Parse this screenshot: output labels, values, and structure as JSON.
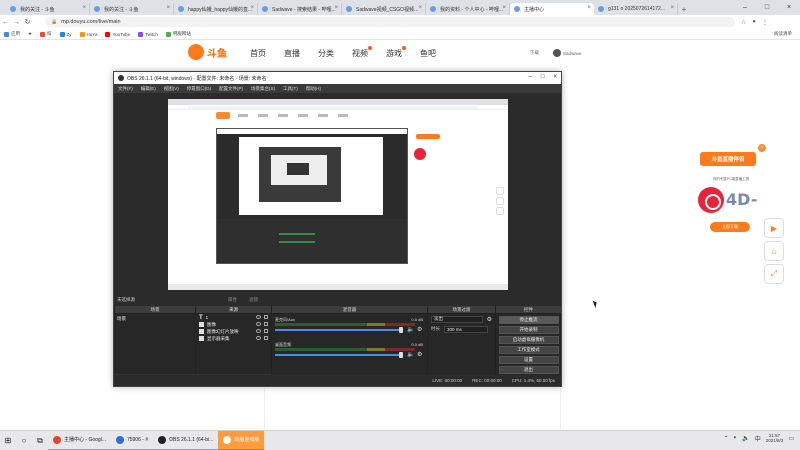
{
  "browser": {
    "tabs": [
      {
        "title": "我的关注 - 斗鱼"
      },
      {
        "title": "我的关注 - 斗鱼"
      },
      {
        "title": "happy仙娥_happy仙娥的直..."
      },
      {
        "title": "Sadwave - 搜索结果 - 哔哩..."
      },
      {
        "title": "Sadwave视频_CSGO视频..."
      },
      {
        "title": "我的资料 - 个人中心 - 哔哩..."
      },
      {
        "title": "主播中心",
        "active": true
      },
      {
        "title": "g131 o 2025072614172..."
      }
    ],
    "url": "mp.douyu.com/live/main",
    "bookmarks": [
      {
        "label": "应用",
        "color": "#4285f4"
      },
      {
        "label": "★",
        "color": "#fbbc04"
      },
      {
        "label": "扣",
        "color": "#e74c3c"
      },
      {
        "label": "Zy",
        "color": "#1e88e5"
      },
      {
        "label": "HuYa",
        "color": "#ff9800"
      },
      {
        "label": "YouTube",
        "color": "#ff0000"
      },
      {
        "label": "Twitch",
        "color": "#9146ff"
      },
      {
        "label": "韩服网站",
        "color": "#4caf50"
      }
    ],
    "bookmarks_right": "阅读清单"
  },
  "douyu": {
    "logo": "斗鱼",
    "nav": [
      "首页",
      "直播",
      "分类",
      "视频",
      "游戏",
      "鱼吧"
    ],
    "right": {
      "download": "下载",
      "user": "Sadwave"
    }
  },
  "ad": {
    "title": "斗鱼直播伴侣",
    "subtitle": "你的专属PC端直播工具",
    "big": "4D-",
    "button": "立即下载",
    "close": "×"
  },
  "obs": {
    "title": "OBS 26.1.1 (64-bit, windows) - 配置文件: 未命名 - 场景: 未命名",
    "menu": [
      "文件(F)",
      "编辑(E)",
      "视图(V)",
      "停靠窗口(D)",
      "配置文件(P)",
      "场景集合(S)",
      "工具(T)",
      "帮助(H)"
    ],
    "dock_label": "未选择源",
    "dock_tools": [
      "属性",
      "滤镜"
    ],
    "panels": {
      "scenes": {
        "header": "场景",
        "items": [
          "场景"
        ]
      },
      "sources": {
        "header": "来源",
        "items": [
          "1",
          "图像",
          "图像幻灯片放映",
          "显示器采集"
        ]
      },
      "mixer": {
        "header": "混音器",
        "rows": [
          {
            "name": "麦克风/Aux",
            "db": "0.0 dB"
          },
          {
            "name": "桌面音频",
            "db": "0.0 dB"
          }
        ]
      },
      "transitions": {
        "header": "场景过渡",
        "type": "淡出",
        "duration_label": "时长",
        "duration": "300 ms"
      },
      "controls": {
        "header": "控件",
        "buttons": [
          "停止推流",
          "开始录制",
          "启动虚拟摄像机",
          "工作室模式",
          "设置",
          "退出"
        ]
      }
    },
    "status": {
      "live": "LIVE: 00:00:00",
      "rec": "REC: 00:00:00",
      "cpu": "CPU: 1.4%, 60.00 fps"
    }
  },
  "taskbar": {
    "apps": [
      {
        "label": "主播中心 - Googl...",
        "color": "#e94235"
      },
      {
        "label": "75906 - #",
        "color": "#2a72d8"
      },
      {
        "label": "OBS 26.1.1 (64-bi...",
        "color": "#222222"
      },
      {
        "label": "韩服连线版",
        "color": "#ffffff",
        "active": true
      }
    ],
    "time": "21:57",
    "date": "2021/8/3"
  }
}
